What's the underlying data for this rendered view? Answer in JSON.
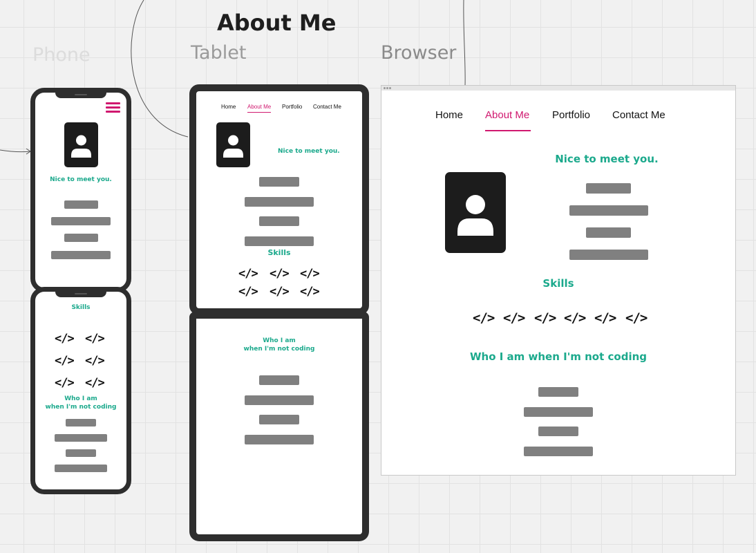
{
  "page_title": "About Me",
  "frame_labels": {
    "phone": "Phone",
    "tablet": "Tablet",
    "browser": "Browser"
  },
  "nav": {
    "home": "Home",
    "about": "About Me",
    "portfolio": "Portfolio",
    "contact": "Contact Me"
  },
  "content": {
    "greeting": "Nice to meet you.",
    "skills_heading": "Skills",
    "hobbies_heading": "Who I am when I'm not coding",
    "hobbies_heading_line1": "Who I am",
    "hobbies_heading_line2": "when I'm not coding"
  },
  "icons": {
    "code_glyph": "</>",
    "avatar": "user-avatar-icon",
    "menu": "hamburger-menu-icon"
  },
  "colors": {
    "accent": "#d0186f",
    "heading_green": "#1ba98c",
    "placeholder_gray": "#808080",
    "frame": "#2e2e2e"
  }
}
